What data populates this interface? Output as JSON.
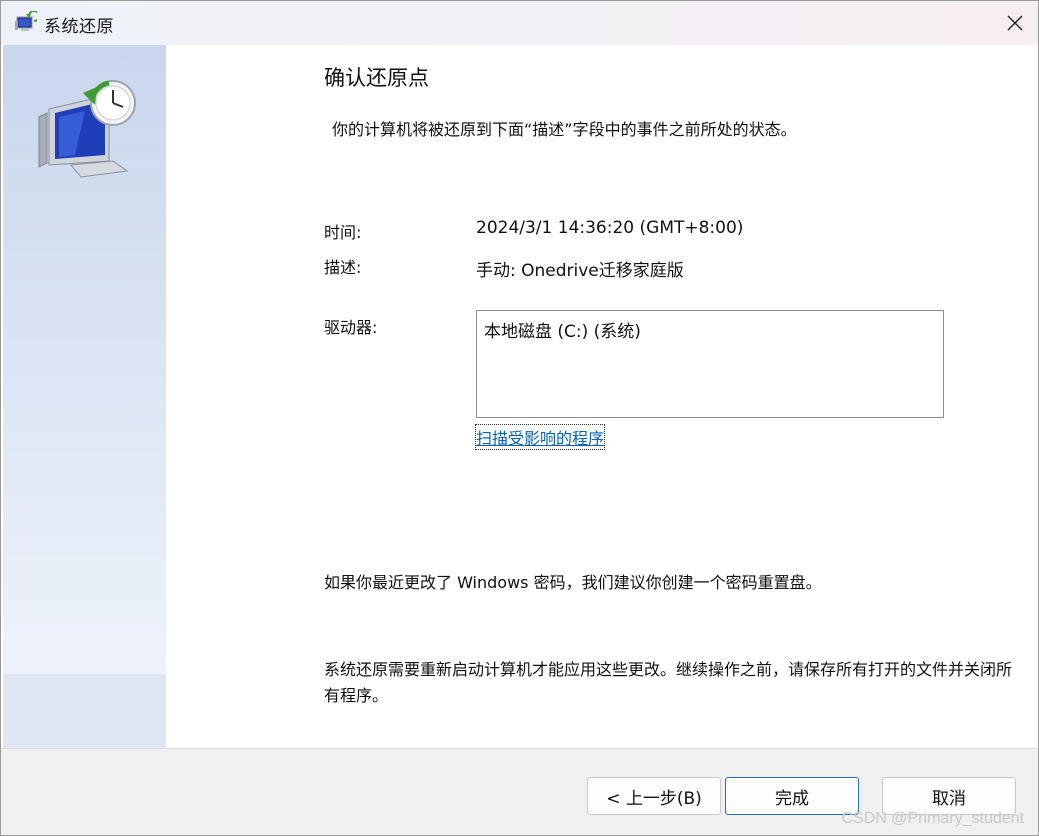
{
  "window": {
    "title": "系统还原",
    "close_icon": "close-icon"
  },
  "main": {
    "heading": "确认还原点",
    "intro": "你的计算机将被还原到下面“描述”字段中的事件之前所处的状态。",
    "time_label": "时间:",
    "time_value": "2024/3/1 14:36:20 (GMT+8:00)",
    "desc_label": "描述:",
    "desc_value": "手动: Onedrive迁移家庭版",
    "drive_label": "驱动器:",
    "drives": [
      "本地磁盘 (C:) (系统)"
    ],
    "scan_link": "扫描受影响的程序",
    "password_note": "如果你最近更改了 Windows 密码，我们建议你创建一个密码重置盘。",
    "restart_note": "系统还原需要重新启动计算机才能应用这些更改。继续操作之前，请保存所有打开的文件并关闭所有程序。"
  },
  "footer": {
    "back_label": "< 上一步(B)",
    "finish_label": "完成",
    "cancel_label": "取消"
  },
  "watermark": "CSDN @Primary_student",
  "colors": {
    "link": "#0b63ad",
    "sidebar": "#dde6f4",
    "footer": "#f0f0f0",
    "primary_border": "#2f6fba"
  }
}
